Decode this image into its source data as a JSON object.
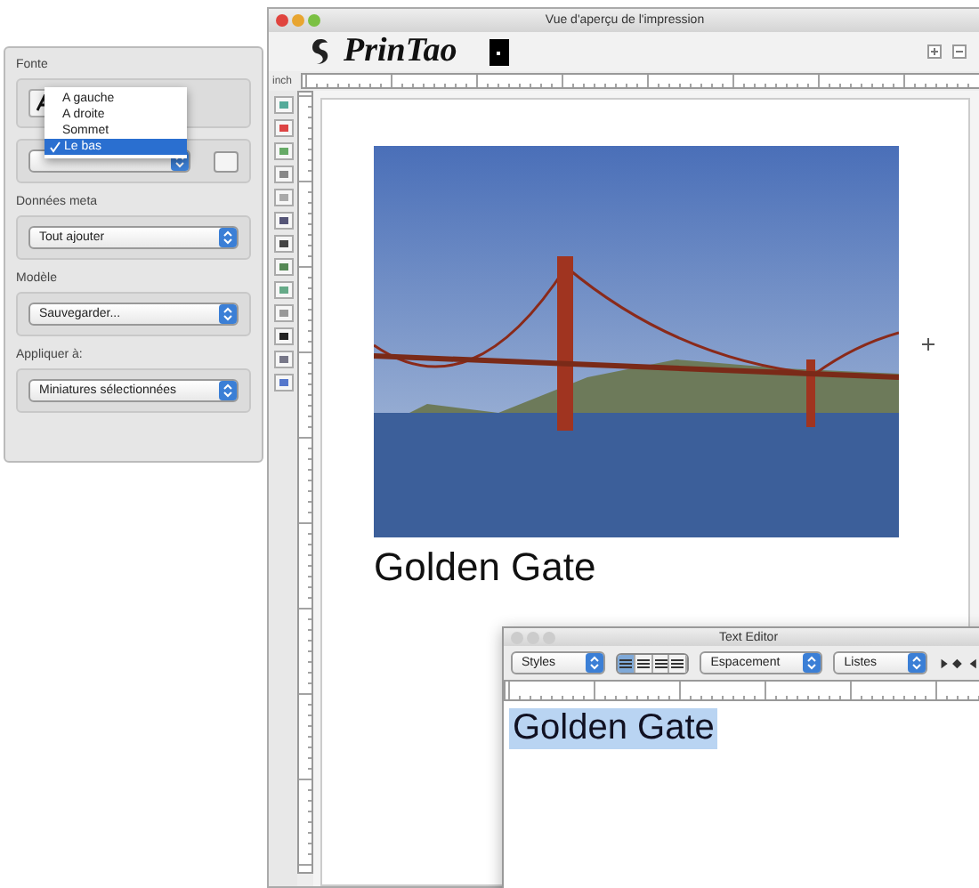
{
  "inspector": {
    "font_section": {
      "label": "Fonte",
      "menu": [
        {
          "label": "A gauche",
          "selected": false
        },
        {
          "label": "A droite",
          "selected": false
        },
        {
          "label": "Sommet",
          "selected": false
        },
        {
          "label": "Le bas",
          "selected": true
        }
      ]
    },
    "sections": [
      {
        "label": "Données meta",
        "value": "Tout ajouter"
      },
      {
        "label": "Modèle",
        "value": "Sauvegarder..."
      },
      {
        "label": "Appliquer à:",
        "value": "Miniatures sélectionnées"
      }
    ]
  },
  "preview_window": {
    "title": "Vue d'aperçu de l'impression",
    "logo": "PrinTao",
    "ruler_unit": "inch",
    "caption": "Golden Gate"
  },
  "text_editor": {
    "title": "Text Editor",
    "controls": [
      {
        "kind": "select",
        "label": "Styles"
      },
      {
        "kind": "segmented",
        "items": [
          {
            "selected": true
          },
          {
            "selected": false
          },
          {
            "selected": false
          },
          {
            "selected": false
          }
        ]
      },
      {
        "kind": "select",
        "label": "Espacement"
      },
      {
        "kind": "select",
        "label": "Listes"
      }
    ],
    "text": "Golden Gate",
    "highlighted": true
  }
}
